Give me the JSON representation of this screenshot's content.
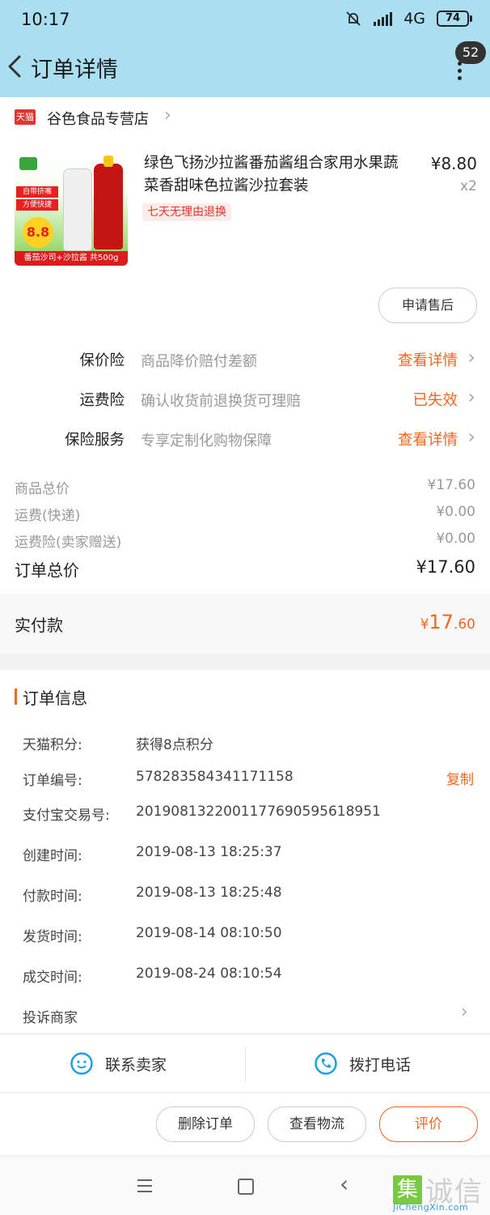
{
  "status_bar": {
    "time": "10:17",
    "network": "4G",
    "battery": "74"
  },
  "header": {
    "title": "订单详情",
    "notification_count": "52"
  },
  "shop": {
    "tag": "天猫",
    "name": "谷色食品专营店"
  },
  "product": {
    "title": "绿色飞扬沙拉酱番茄酱组合家用水果蔬菜香甜味色拉酱沙拉套装",
    "return_policy": "七天无理由退换",
    "price": "¥8.80",
    "quantity": "x2",
    "image_text": {
      "badge1": "自带挤嘴",
      "badge2": "方便快捷",
      "price_badge": "8.8",
      "bottom": "番茄沙司+沙拉酱 共500g"
    }
  },
  "after_sale_button": "申请售后",
  "services": [
    {
      "label": "保价险",
      "desc": "商品降价赔付差额",
      "action": "查看详情"
    },
    {
      "label": "运费险",
      "desc": "确认收货前退换货可理赔",
      "action": "已失效"
    },
    {
      "label": "保险服务",
      "desc": "专享定制化购物保障",
      "action": "查看详情"
    }
  ],
  "summary": [
    {
      "label": "商品总价",
      "value": "¥17.60"
    },
    {
      "label": "运费(快递)",
      "value": "¥0.00"
    },
    {
      "label": "运费险(卖家赠送)",
      "value": "¥0.00"
    }
  ],
  "order_total": {
    "label": "订单总价",
    "value": "¥17.60"
  },
  "paid": {
    "label": "实付款",
    "currency": "¥",
    "integer": "17",
    "decimal": ".60"
  },
  "order_info": {
    "title": "订单信息",
    "copy_label": "复制",
    "rows": [
      {
        "label": "天猫积分:",
        "value": "获得8点积分"
      },
      {
        "label": "订单编号:",
        "value": "578283584341171158"
      },
      {
        "label": "支付宝交易号:",
        "value": "2019081322001177690595618951"
      },
      {
        "label": "创建时间:",
        "value": "2019-08-13 18:25:37"
      },
      {
        "label": "付款时间:",
        "value": "2019-08-13 18:25:48"
      },
      {
        "label": "发货时间:",
        "value": "2019-08-14 08:10:50"
      },
      {
        "label": "成交时间:",
        "value": "2019-08-24 08:10:54"
      }
    ],
    "complaint": "投诉商家"
  },
  "contact": {
    "seller": "联系卖家",
    "call": "拨打电话"
  },
  "actions": {
    "delete": "删除订单",
    "logistics": "查看物流",
    "review": "评价"
  },
  "watermark": {
    "box": "集",
    "text": "诚信",
    "url": "JiChengXin.com"
  },
  "colors": {
    "header_bg": "#a9dff0",
    "accent": "#f2661f",
    "tmall_red": "#e4342d",
    "contact_blue": "#1aa0e6"
  }
}
